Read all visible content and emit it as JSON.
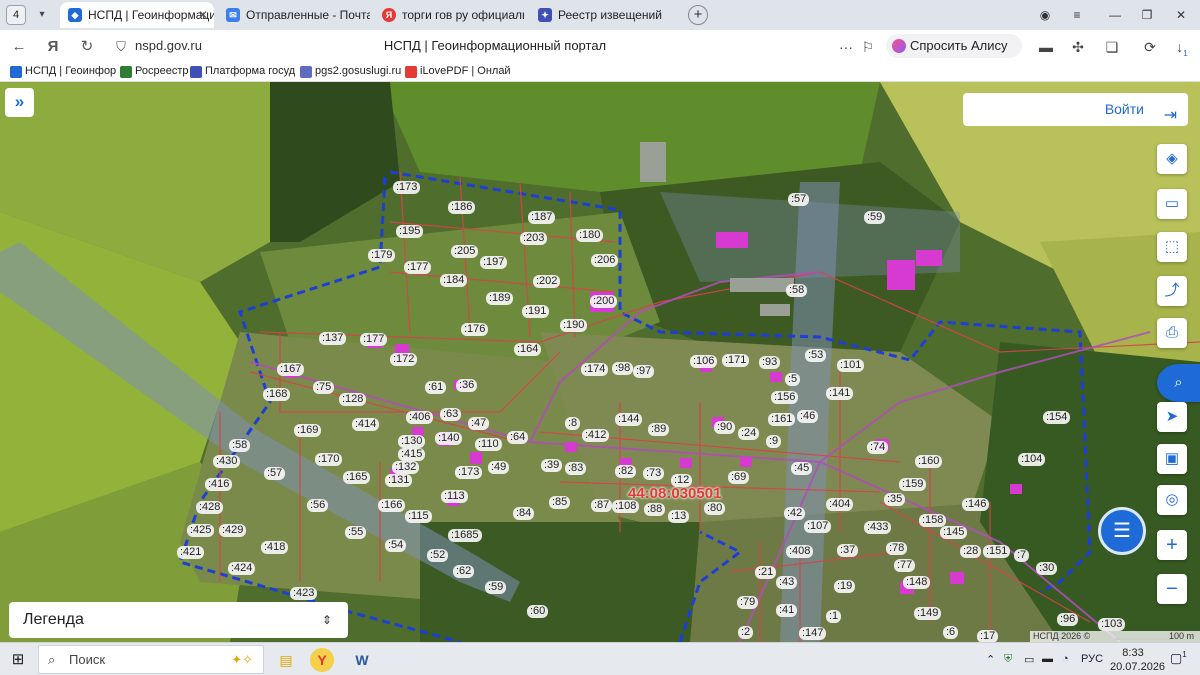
{
  "browser": {
    "tab_count": "4",
    "tabs": [
      {
        "label": "НСПД | Геоинформаци",
        "active": true,
        "color": "#1e6ad6"
      },
      {
        "label": "Отправленные - Почта",
        "active": false,
        "color": "#3d7ef0"
      },
      {
        "label": "торги гов ру официальн",
        "active": false,
        "color": "#e53935"
      },
      {
        "label": "Реестр извещений",
        "active": false,
        "color": "#3f51b5"
      }
    ],
    "url": "nspd.gov.ru",
    "page_title": "НСПД | Геоинформационный портал",
    "alice_label": "Спросить Алису AI",
    "download_badge": "1",
    "bookmarks": [
      {
        "label": "НСПД | Геоинфор",
        "color": "#1e6ad6"
      },
      {
        "label": "Росреестр",
        "color": "#2e7d32"
      },
      {
        "label": "Платформа госуд",
        "color": "#3f51b5"
      },
      {
        "label": "pgs2.gosuslugi.ru",
        "color": "#5c6bc0"
      },
      {
        "label": "iLovePDF | Онлай",
        "color": "#e53935"
      }
    ]
  },
  "map": {
    "login_label": "Войти",
    "legend_label": "Легенда",
    "cadastral_quarter": "44:08:030501",
    "attribution": "НСПД 2026 ©",
    "scale": "100 m",
    "accent_color": "#1e6ad6",
    "parcel_labels": [
      ":173",
      ":186",
      ":187",
      ":195",
      ":203",
      ":180",
      ":179",
      ":177",
      ":205",
      ":197",
      ":206",
      ":184",
      ":202",
      ":189",
      ":191",
      ":200",
      ":176",
      ":190",
      ":164",
      ":137",
      ":177",
      ":172",
      ":167",
      ":75",
      ":36",
      ":61",
      ":168",
      ":128",
      ":406",
      ":63",
      ":414",
      ":47",
      ":169",
      ":130",
      ":140",
      ":110",
      ":64",
      ":58",
      ":415",
      ":170",
      ":132",
      ":430",
      ":57",
      ":165",
      ":131",
      ":173",
      ":49",
      ":416",
      ":113",
      ":166",
      ":56",
      ":428",
      ":115",
      ":55",
      ":1685",
      ":425",
      ":429",
      ":418",
      ":54",
      ":52",
      ":421",
      ":424",
      ":62",
      ":59",
      ":423",
      ":60",
      ":57",
      ":59",
      ":58",
      ":106",
      ":171",
      ":93",
      ":53",
      ":174",
      ":98",
      ":97",
      ":5",
      ":101",
      ":156",
      ":141",
      ":46",
      ":8",
      ":412",
      ":144",
      ":89",
      ":90",
      ":24",
      ":161",
      ":9",
      ":74",
      ":154",
      ":45",
      ":39",
      ":83",
      ":82",
      ":73",
      ":12",
      ":69",
      ":160",
      ":104",
      ":159",
      ":84",
      ":85",
      ":87",
      ":108",
      ":88",
      ":13",
      ":80",
      ":35",
      ":146",
      ":42",
      ":404",
      ":107",
      ":433",
      ":158",
      ":145",
      ":78",
      ":28",
      ":151",
      ":7",
      ":408",
      ":37",
      ":77",
      ":30",
      ":21",
      ":43",
      ":148",
      ":19",
      ":79",
      ":41",
      ":149",
      ":96",
      ":103",
      ":2",
      ":147",
      ":1",
      ":6",
      ":17"
    ]
  },
  "taskbar": {
    "search_label": "Поиск",
    "lang": "РУС",
    "time": "8:33",
    "date": "20.07.2026",
    "notification_count": "1"
  }
}
